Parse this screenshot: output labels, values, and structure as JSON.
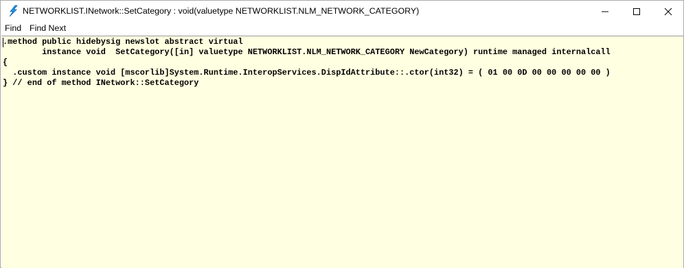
{
  "window": {
    "title": "NETWORKLIST.INetwork::SetCategory : void(valuetype NETWORKLIST.NLM_NETWORK_CATEGORY)",
    "app_icon": "ildasm-icon",
    "controls": {
      "minimize": "minimize-icon",
      "maximize": "maximize-icon",
      "close": "close-icon"
    }
  },
  "menu": {
    "find": "Find",
    "find_next": "Find Next"
  },
  "code": {
    "lines": [
      ".method public hidebysig newslot abstract virtual",
      "        instance void  SetCategory([in] valuetype NETWORKLIST.NLM_NETWORK_CATEGORY NewCategory) runtime managed internalcall",
      "{",
      "  .custom instance void [mscorlib]System.Runtime.InteropServices.DispIdAttribute::.ctor(int32) = ( 01 00 0D 00 00 00 00 00 )",
      "} // end of method INetwork::SetCategory"
    ]
  },
  "colors": {
    "editor_background": "#ffffe1",
    "icon_accent": "#1e90ff"
  }
}
